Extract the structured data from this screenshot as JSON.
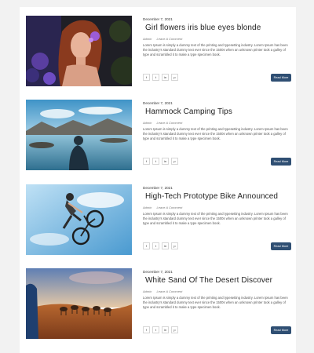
{
  "posts": [
    {
      "date": "December 7, 2021",
      "title": "Girl flowers iris blue eyes blonde",
      "author": "Admin",
      "comment_label": "Leave A Comment",
      "excerpt_lines": [
        "Lorem Ipsum is simply a dummy text of the printing and typesetting industry. Lorem Ipsum has been",
        "the industry's standard dummy text ever since the 1500s when an unknown printer took a galley of",
        "type and scrambled it to make a type specimen book."
      ],
      "read_more": "Read More"
    },
    {
      "date": "December 7, 2021",
      "title": "Hammock Camping Tips",
      "author": "Admin",
      "comment_label": "Leave A Comment",
      "excerpt_lines": [
        "Lorem Ipsum is simply a dummy text of the printing and typesetting industry. Lorem Ipsum has been",
        "the industry's standard dummy text ever since the 1500s when an unknown printer took a galley of",
        "type and scrambled it to make a type specimen book."
      ],
      "read_more": "Read More"
    },
    {
      "date": "December 7, 2021",
      "title": "High-Tech Prototype Bike Announced",
      "author": "Admin",
      "comment_label": "Leave A Comment",
      "excerpt_lines": [
        "Lorem Ipsum is simply a dummy text of the printing and typesetting industry. Lorem Ipsum has been",
        "the industry's standard dummy text ever since the 1500s when an unknown printer took a galley of",
        "type and scrambled it to make a type specimen book."
      ],
      "read_more": "Read More"
    },
    {
      "date": "December 7, 2021",
      "title": "White Sand Of The Desert Discover",
      "author": "Admin",
      "comment_label": "Leave A Comment",
      "excerpt_lines": [
        "Lorem Ipsum is simply a dummy text of the printing and typesetting industry. Lorem Ipsum has been",
        "the industry's standard dummy text ever since the 1500s when an unknown printer took a galley of",
        "type and scrambled it to make a type specimen book."
      ],
      "read_more": "Read More"
    }
  ],
  "share_icons": [
    {
      "name": "facebook-icon",
      "glyph": "f"
    },
    {
      "name": "twitter-icon",
      "glyph": "t"
    },
    {
      "name": "linkedin-icon",
      "glyph": "in"
    },
    {
      "name": "pinterest-icon",
      "glyph": "p"
    }
  ],
  "colors": {
    "page_background": "#f2f2f2",
    "panel_background": "#ffffff",
    "read_more_button": "#2f4f73"
  }
}
